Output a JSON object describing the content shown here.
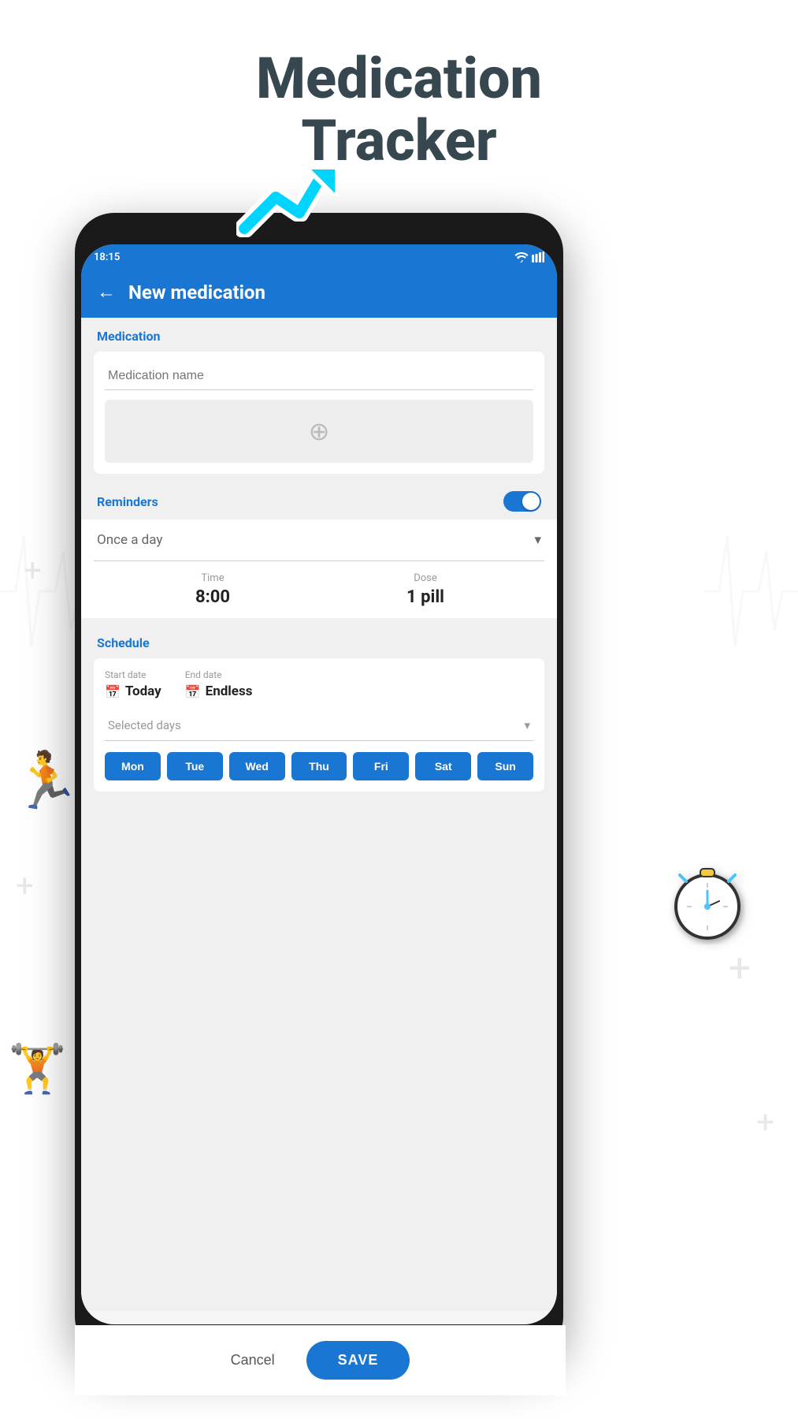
{
  "page": {
    "title_line1": "Medication",
    "title_line2": "Tracker"
  },
  "status_bar": {
    "time": "18:15",
    "wifi_icon": "▼",
    "signal_icon": "▲"
  },
  "header": {
    "back_label": "←",
    "title": "New medication"
  },
  "medication_section": {
    "label": "Medication",
    "name_placeholder": "Medication name",
    "add_photo_icon": "⊕"
  },
  "reminders": {
    "label": "Reminders",
    "enabled": true
  },
  "frequency": {
    "value": "Once a day",
    "dropdown_icon": "▾"
  },
  "time_dose": {
    "time_label": "Time",
    "time_value": "8:00",
    "dose_label": "Dose",
    "dose_value": "1 pill"
  },
  "schedule": {
    "label": "Schedule",
    "start_date_label": "Start date",
    "start_date_value": "Today",
    "end_date_label": "End date",
    "end_date_value": "Endless",
    "days_dropdown_value": "Selected days",
    "days": [
      "Mon",
      "Tue",
      "Wed",
      "Thu",
      "Fri",
      "Sat",
      "Sun"
    ]
  },
  "actions": {
    "cancel_label": "Cancel",
    "save_label": "SAVE"
  },
  "arrow_icon": "↗",
  "stopwatch_emoji": "⏱"
}
